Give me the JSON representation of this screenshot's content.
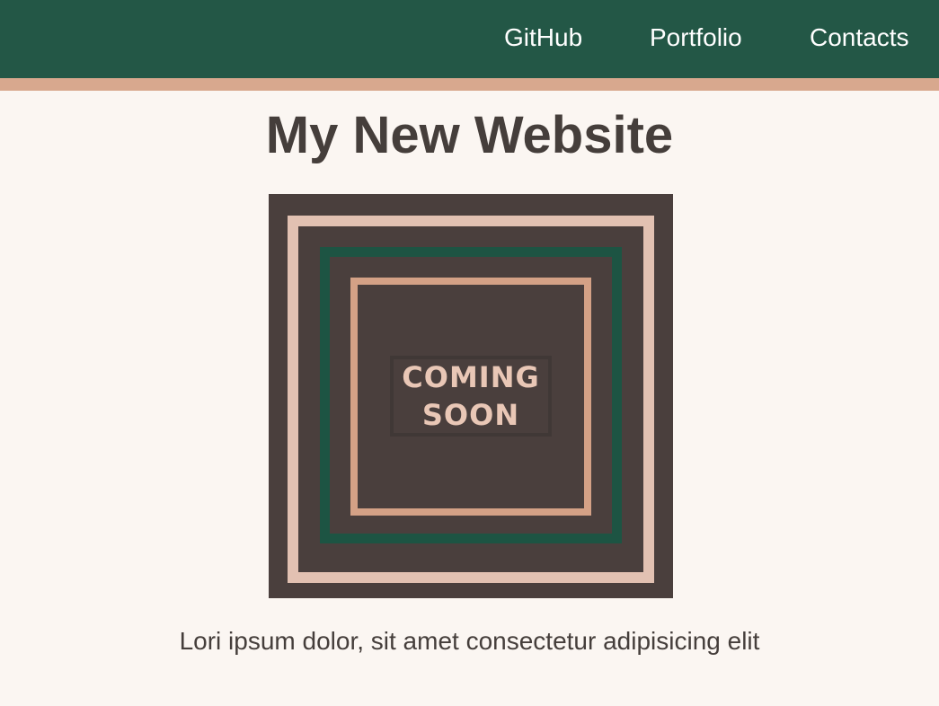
{
  "nav": {
    "links": [
      "GitHub",
      "Portfolio",
      "Contacts"
    ]
  },
  "main": {
    "title": "My New Website",
    "hero_image": {
      "line1": "COMING",
      "line2": "SOON"
    },
    "paragraph": "Lori ipsum dolor, sit amet consectetur adipisicing elit"
  },
  "colors": {
    "navbar": "#235746",
    "navbar_border": "#d8a88e",
    "page_background": "#fbf6f2",
    "text": "#453e3b",
    "hero_background": "#4a3f3d",
    "frame_outer": "#e2c1b2",
    "frame_middle": "#1d5443",
    "frame_inner": "#d4a186"
  }
}
